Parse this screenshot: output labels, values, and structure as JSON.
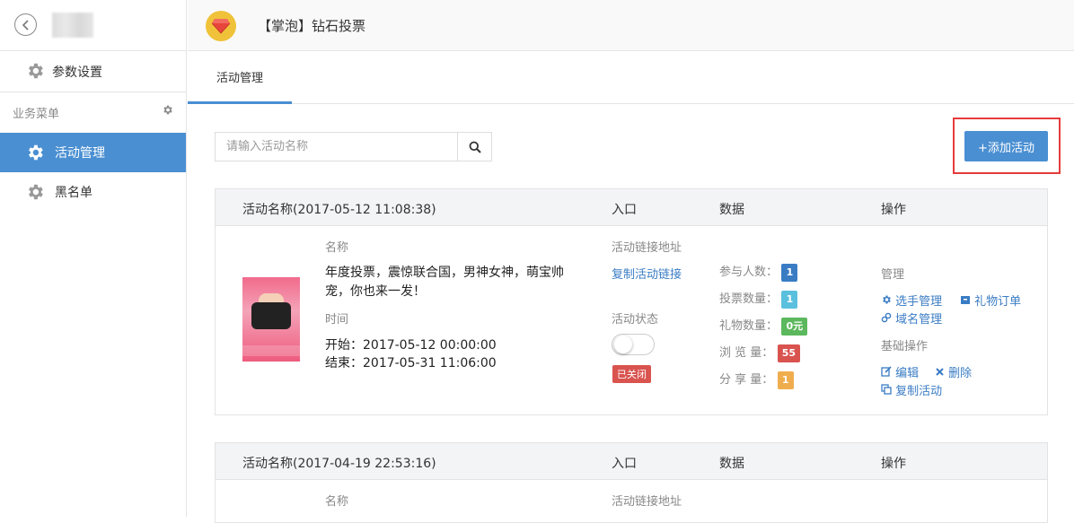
{
  "sidebar": {
    "param_label": "参数设置",
    "section_label": "业务菜单",
    "items": [
      {
        "label": "活动管理",
        "active": true
      },
      {
        "label": "黑名单",
        "active": false
      }
    ]
  },
  "header": {
    "title": "【掌泡】钻石投票"
  },
  "tabs": [
    {
      "label": "活动管理",
      "active": true
    }
  ],
  "search": {
    "placeholder": "请输入活动名称",
    "value": ""
  },
  "add_button": "+添加活动",
  "table_headers": {
    "entry": "入口",
    "data": "数据",
    "ops": "操作"
  },
  "activities": [
    {
      "header_name": "活动名称(2017-05-12 11:08:38)",
      "name_label": "名称",
      "name": "年度投票，震惊联合国，男神女神，萌宝帅宠，你也来一发！",
      "time_label": "时间",
      "start": "开始：2017-05-12 00:00:00",
      "end": "结束：2017-05-31 11:06:00",
      "link_label": "活动链接地址",
      "copy_link": "复制活动链接",
      "status_label": "活动状态",
      "status": "已关闭",
      "stats": [
        {
          "label": "参与人数：",
          "value": "1",
          "color": "#3a7cc4"
        },
        {
          "label": "投票数量：",
          "value": "1",
          "color": "#5bc0de"
        },
        {
          "label": "礼物数量：",
          "value": "0元",
          "color": "#5cb85c"
        },
        {
          "label": "浏 览 量：",
          "value": "55",
          "color": "#d9534f"
        },
        {
          "label": "分 享 量：",
          "value": "1",
          "color": "#f0ad4e"
        }
      ],
      "manage_label": "管理",
      "manage_links": [
        "选手管理",
        "礼物订单",
        "域名管理"
      ],
      "basic_label": "基础操作",
      "basic_links": [
        "编辑",
        "删除",
        "复制活动"
      ]
    },
    {
      "header_name": "活动名称(2017-04-19 22:53:16)",
      "name_label": "名称",
      "link_label": "活动链接地址"
    }
  ]
}
